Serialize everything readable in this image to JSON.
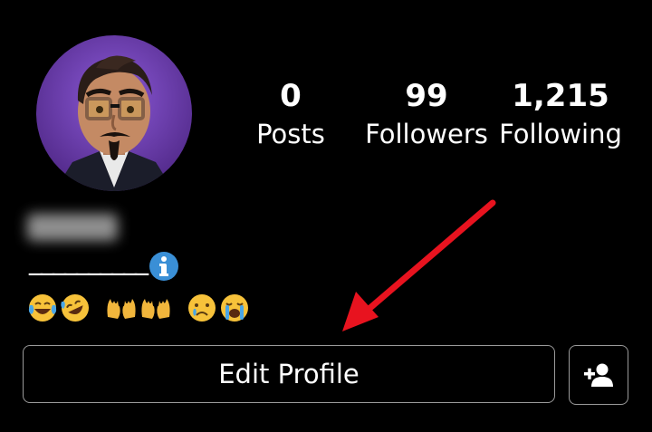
{
  "profile": {
    "stats": [
      {
        "value": "0",
        "label": "Posts"
      },
      {
        "value": "99",
        "label": "Followers"
      },
      {
        "value": "1,215",
        "label": "Following"
      }
    ],
    "bio_line": "__________",
    "emojis": [
      "face-with-tears-of-joy",
      "rolling-on-floor-laughing",
      "raising-hands",
      "raising-hands",
      "crying-face",
      "face-screaming-in-fear"
    ]
  },
  "actions": {
    "edit_profile_label": "Edit Profile",
    "add_person_icon": "add-person-icon"
  },
  "colors": {
    "background": "#000000",
    "text": "#ffffff",
    "button_border": "#9a9a9a",
    "annotation_arrow": "#e8131f",
    "info_badge": "#3a8fd6"
  }
}
